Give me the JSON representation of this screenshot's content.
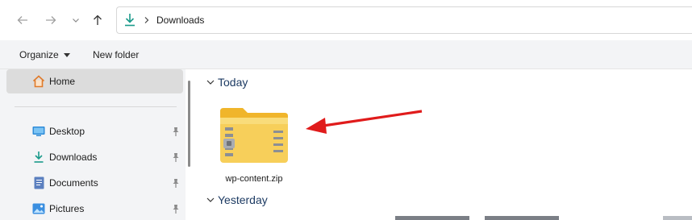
{
  "window": {
    "edge_glyph": "e"
  },
  "nav": {
    "back_icon": "arrow-left-icon",
    "forward_icon": "arrow-right-icon",
    "recent_icon": "chevron-down-icon",
    "up_icon": "arrow-up-icon"
  },
  "address": {
    "icon": "download-icon",
    "crumb": "Downloads"
  },
  "toolbar": {
    "organize": "Organize",
    "new_folder": "New folder"
  },
  "sidebar": {
    "home": "Home",
    "items": [
      {
        "label": "Desktop",
        "icon": "desktop-icon"
      },
      {
        "label": "Downloads",
        "icon": "download-icon"
      },
      {
        "label": "Documents",
        "icon": "documents-icon"
      },
      {
        "label": "Pictures",
        "icon": "pictures-icon"
      }
    ]
  },
  "content": {
    "groups": [
      {
        "label": "Today"
      },
      {
        "label": "Yesterday"
      }
    ],
    "files": [
      {
        "name": "wp-content.zip",
        "icon": "zip-folder-icon"
      }
    ]
  },
  "colors": {
    "accent": "#1d3b63",
    "download_green": "#1a9a8a",
    "folder_yellow": "#f5c342",
    "arrow_red": "#e01b1b"
  }
}
